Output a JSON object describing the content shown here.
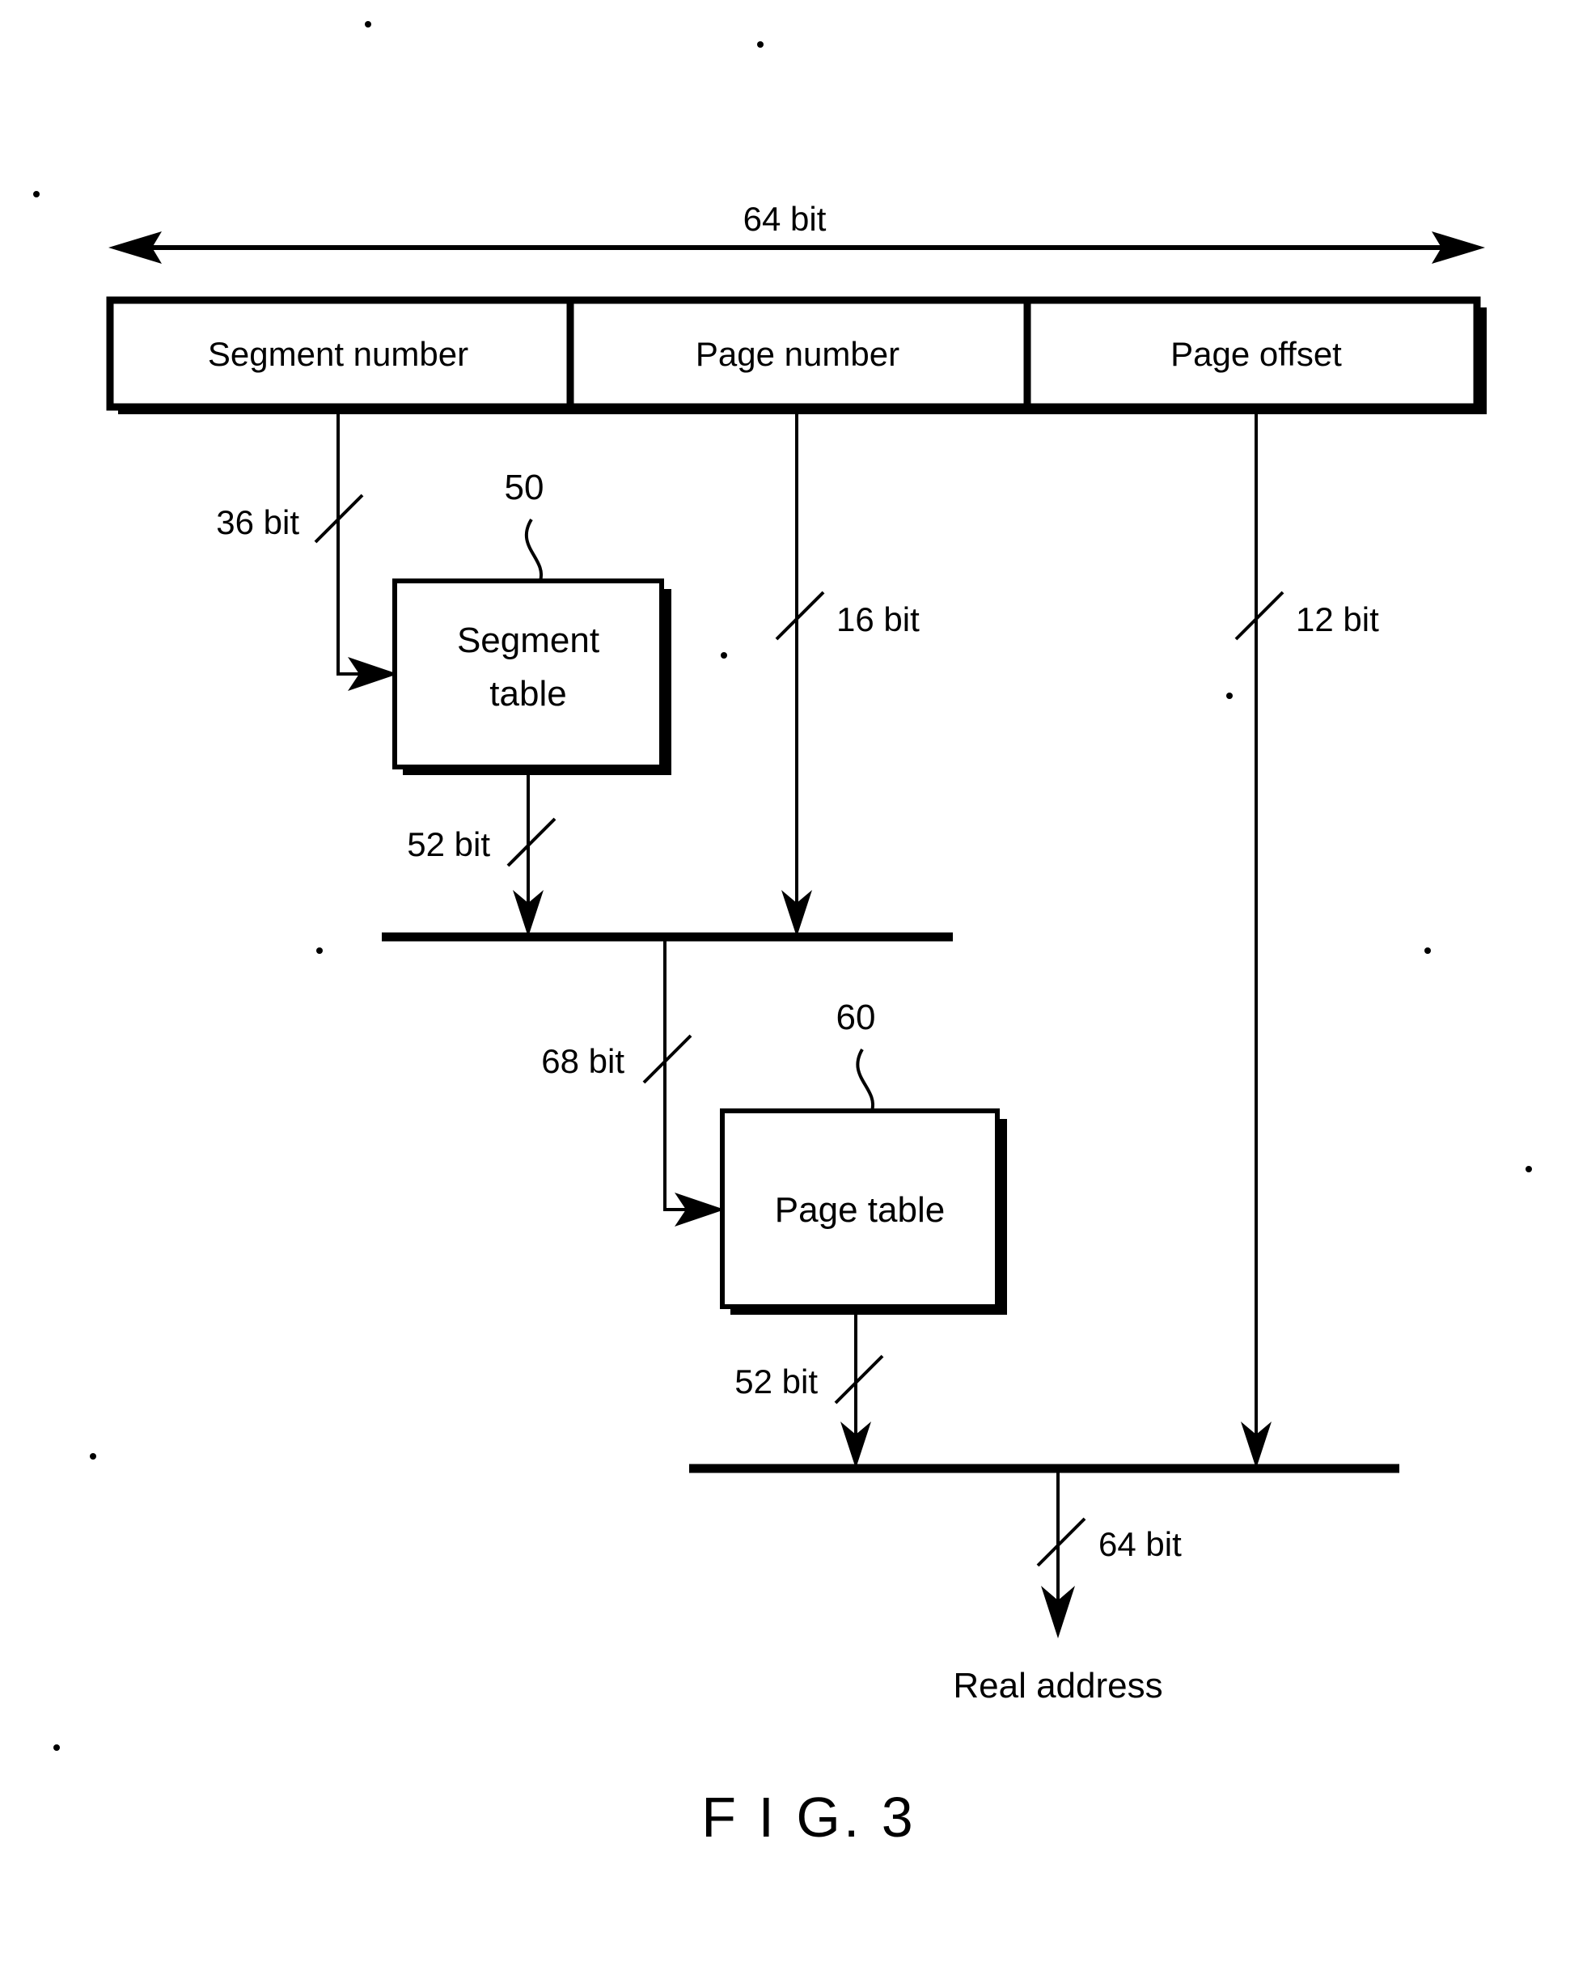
{
  "figure": {
    "caption": "F I G. 3",
    "top_dimension": "64 bit",
    "address_fields": [
      {
        "name": "segment-number",
        "label": "Segment number"
      },
      {
        "name": "page-number",
        "label": "Page number"
      },
      {
        "name": "page-offset",
        "label": "Page offset"
      }
    ],
    "bit_widths": {
      "segment_number_out": "36 bit",
      "page_number_out": "16 bit",
      "page_offset_out": "12 bit",
      "segment_table_out": "52 bit",
      "merged_bus_1": "68 bit",
      "page_table_out": "52 bit",
      "real_address_out": "64 bit"
    },
    "blocks": [
      {
        "name": "segment-table",
        "label_line1": "Segment",
        "label_line2": "table",
        "ref": "50"
      },
      {
        "name": "page-table",
        "label_line1": "Page  table",
        "label_line2": "",
        "ref": "60"
      }
    ],
    "output": {
      "label": "Real address"
    }
  }
}
